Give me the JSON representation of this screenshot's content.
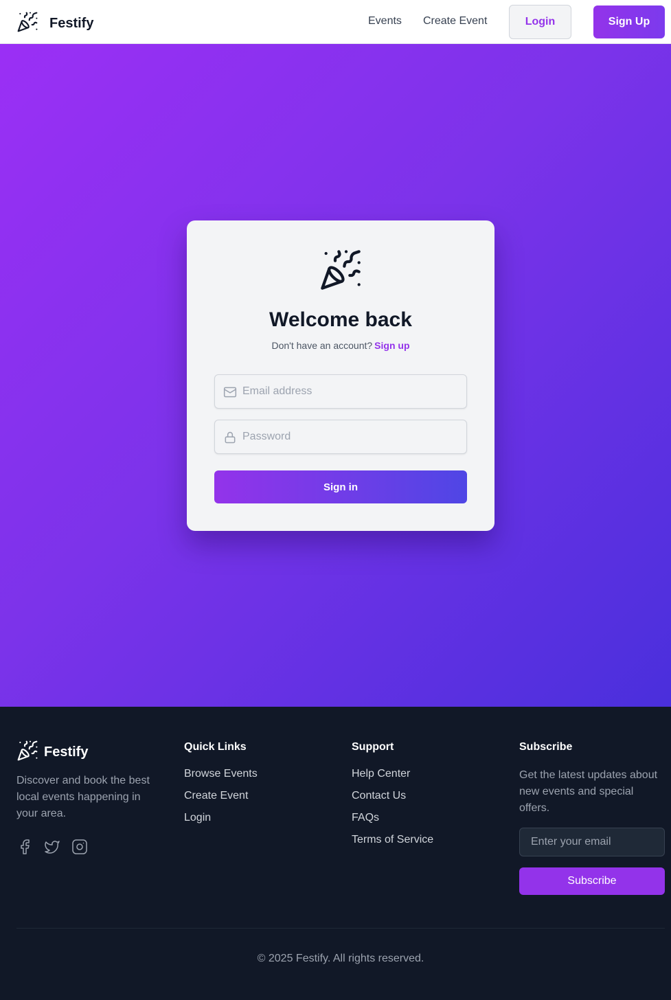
{
  "header": {
    "brand_name": "Festify",
    "nav": {
      "events": "Events",
      "create_event": "Create Event"
    },
    "login_label": "Login",
    "signup_label": "Sign Up"
  },
  "login_card": {
    "icon": "party-popper-icon",
    "title": "Welcome back",
    "no_account_text": "Don't have an account?",
    "signup_link": "Sign up",
    "email": {
      "placeholder": "Email address",
      "value": "",
      "icon": "mail-icon"
    },
    "password": {
      "placeholder": "Password",
      "value": "",
      "icon": "lock-icon"
    },
    "submit_label": "Sign in"
  },
  "footer": {
    "brand_name": "Festify",
    "description": "Discover and book the best local events happening in your area.",
    "socials": [
      "facebook-icon",
      "twitter-icon",
      "instagram-icon"
    ],
    "quick_links": {
      "heading": "Quick Links",
      "items": [
        "Browse Events",
        "Create Event",
        "Login"
      ]
    },
    "support": {
      "heading": "Support",
      "items": [
        "Help Center",
        "Contact Us",
        "FAQs",
        "Terms of Service"
      ]
    },
    "subscribe": {
      "heading": "Subscribe",
      "text": "Get the latest updates about new events and special offers.",
      "email_placeholder": "Enter your email",
      "button_label": "Subscribe"
    },
    "copyright": "© 2025 Festify. All rights reserved."
  },
  "colors": {
    "accent": "#9333ea",
    "indigo": "#4f46e5",
    "footer_bg": "#111827"
  }
}
